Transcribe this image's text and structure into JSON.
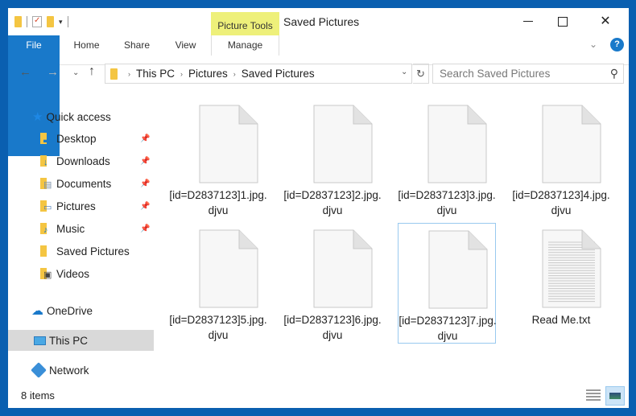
{
  "window": {
    "title": "Saved Pictures",
    "context_tab_group": "Picture Tools",
    "controls": {
      "minimize": "minimize",
      "maximize": "maximize",
      "close": "✕"
    }
  },
  "quick_access_toolbar": {
    "dropdown": "▾"
  },
  "ribbon": {
    "tabs": [
      {
        "label": "File"
      },
      {
        "label": "Home"
      },
      {
        "label": "Share"
      },
      {
        "label": "View"
      },
      {
        "label": "Manage"
      }
    ],
    "help_label": "?",
    "expand_chevron": "⌄"
  },
  "navigation": {
    "back": "←",
    "forward": "→",
    "recent": "⌄",
    "up": "↑",
    "breadcrumb": [
      "This PC",
      "Pictures",
      "Saved Pictures"
    ],
    "breadcrumb_separator": "›",
    "address_dropdown": "⌄",
    "refresh": "↻",
    "search_placeholder": "Search Saved Pictures",
    "search_icon": "⚲"
  },
  "sidebar": {
    "quick_access": "Quick access",
    "pinned": [
      {
        "label": "Desktop",
        "icon": "desktop-folder-icon",
        "pinned": true
      },
      {
        "label": "Downloads",
        "icon": "downloads-folder-icon",
        "pinned": true
      },
      {
        "label": "Documents",
        "icon": "documents-folder-icon",
        "pinned": true
      },
      {
        "label": "Pictures",
        "icon": "pictures-folder-icon",
        "pinned": true
      },
      {
        "label": "Music",
        "icon": "music-folder-icon",
        "pinned": true
      },
      {
        "label": "Saved Pictures",
        "icon": "folder-icon",
        "pinned": false
      },
      {
        "label": "Videos",
        "icon": "videos-folder-icon",
        "pinned": false
      }
    ],
    "onedrive": "OneDrive",
    "this_pc": "This PC",
    "network": "Network",
    "selected": "This PC"
  },
  "files": [
    {
      "name": "[id=D2837123]1.jpg.djvu",
      "type": "blank"
    },
    {
      "name": "[id=D2837123]2.jpg.djvu",
      "type": "blank"
    },
    {
      "name": "[id=D2837123]3.jpg.djvu",
      "type": "blank"
    },
    {
      "name": "[id=D2837123]4.jpg.djvu",
      "type": "blank"
    },
    {
      "name": "[id=D2837123]5.jpg.djvu",
      "type": "blank"
    },
    {
      "name": "[id=D2837123]6.jpg.djvu",
      "type": "blank"
    },
    {
      "name": "[id=D2837123]7.jpg.djvu",
      "type": "blank",
      "focused": true
    },
    {
      "name": "Read Me.txt",
      "type": "text"
    }
  ],
  "status_bar": {
    "item_count": "8 items"
  },
  "colors": {
    "accent": "#1979ca",
    "context_tab": "#eef07a",
    "frame": "#0a5fb0"
  }
}
